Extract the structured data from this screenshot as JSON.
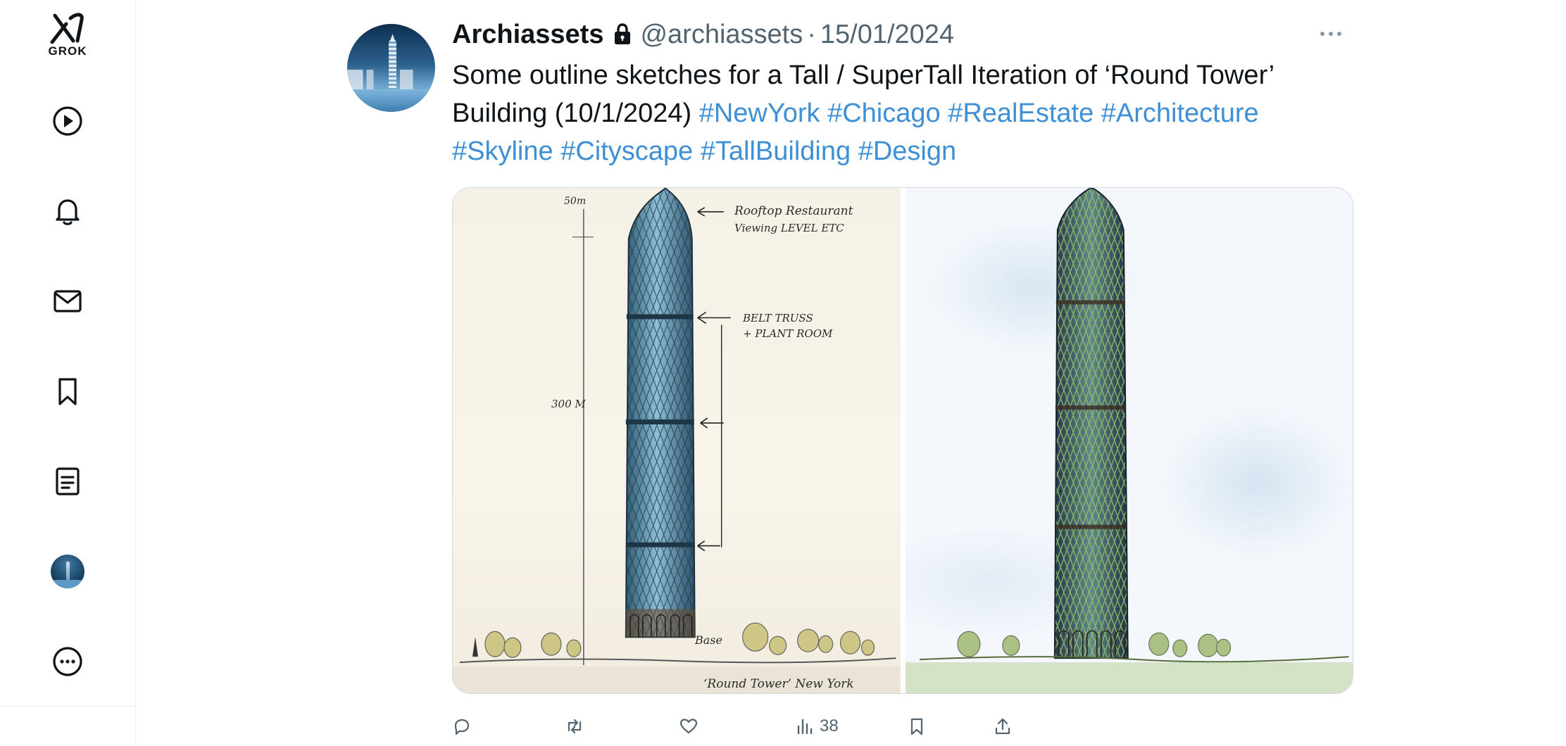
{
  "nav": {
    "logo_label": "GROK",
    "items": [
      {
        "name": "video",
        "icon": "play-circle-icon"
      },
      {
        "name": "notifications",
        "icon": "bell-icon"
      },
      {
        "name": "messages",
        "icon": "mail-icon"
      },
      {
        "name": "bookmarks",
        "icon": "bookmark-icon"
      },
      {
        "name": "lists",
        "icon": "document-icon"
      },
      {
        "name": "profile",
        "icon": "avatar"
      },
      {
        "name": "more",
        "icon": "more-circle-icon"
      }
    ]
  },
  "tweet": {
    "display_name": "Archiassets",
    "protected_icon": "lock-icon",
    "handle": "@archiassets",
    "separator": "·",
    "date": "15/01/2024",
    "text": "Some outline sketches for a Tall / SuperTall Iteration of ‘Round Tower’ Building (10/1/2024) ",
    "hashtags": [
      "#NewYork",
      "#Chicago",
      "#RealEstate",
      "#Architecture",
      "#Skyline",
      "#Cityscape",
      "#TallBuilding",
      "#Design"
    ],
    "media": {
      "left_annotations": {
        "height_top": "50m",
        "height_main": "300 M",
        "rooftop": "Rooftop Restaurant",
        "viewing": "Viewing LEVEL ETC",
        "belt": "BELT TRUSS",
        "plant": "+ PLANT ROOM",
        "base": "Base",
        "caption": "‘Round Tower’ New York"
      }
    },
    "actions": {
      "views_count": "38"
    }
  },
  "colors": {
    "hashtag": "#3d8fd6",
    "secondary_text": "#536471",
    "border": "#cfd9de"
  }
}
